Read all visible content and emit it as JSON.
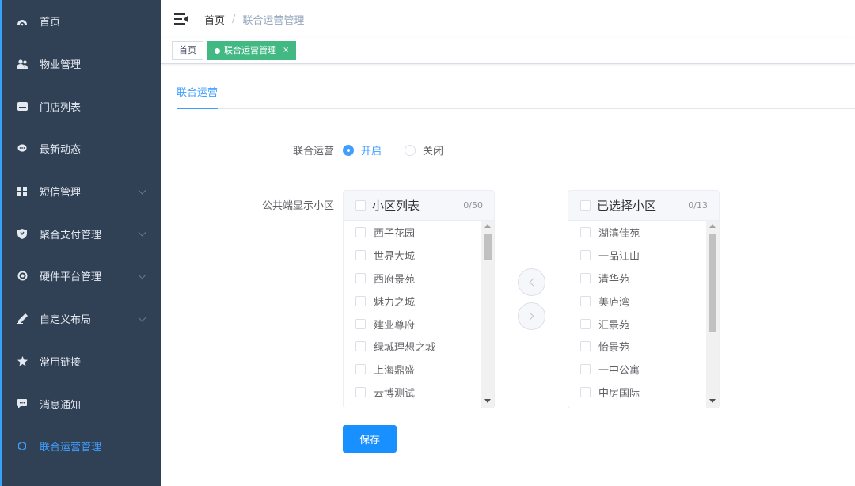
{
  "sidebar": {
    "items": [
      {
        "label": "首页",
        "icon": "dashboard-icon"
      },
      {
        "label": "物业管理",
        "icon": "users-icon"
      },
      {
        "label": "门店列表",
        "icon": "store-icon"
      },
      {
        "label": "最新动态",
        "icon": "chat-icon"
      },
      {
        "label": "短信管理",
        "icon": "grid-icon"
      },
      {
        "label": "聚合支付管理",
        "icon": "shield-icon"
      },
      {
        "label": "硬件平台管理",
        "icon": "chip-icon"
      },
      {
        "label": "自定义布局",
        "icon": "pen-icon"
      },
      {
        "label": "常用链接",
        "icon": "star-icon"
      },
      {
        "label": "消息通知",
        "icon": "message-icon"
      },
      {
        "label": "联合运营管理",
        "icon": "ring-icon"
      }
    ],
    "accent": "#409eff",
    "background": "#304156"
  },
  "breadcrumb": {
    "home": "首页",
    "separator": "/",
    "current": "联合运营管理"
  },
  "tags": {
    "home": "首页",
    "active": "联合运营管理",
    "close": "×"
  },
  "tabs": {
    "active": "联合运营"
  },
  "form": {
    "joint_label": "联合运营",
    "radio_on": "开启",
    "radio_off": "关闭",
    "display_label": "公共端显示小区"
  },
  "transfer": {
    "left": {
      "title": "小区列表",
      "count": "0/50",
      "items": [
        "西子花园",
        "世界大城",
        "西府景苑",
        "魅力之城",
        "建业尊府",
        "绿城理想之城",
        "上海鼎盛",
        "云博测试"
      ]
    },
    "right": {
      "title": "已选择小区",
      "count": "0/13",
      "items": [
        "湖滨佳苑",
        "一品江山",
        "清华苑",
        "美庐湾",
        "汇景苑",
        "怡景苑",
        "一中公寓",
        "中房国际"
      ]
    }
  },
  "save_label": "保存"
}
